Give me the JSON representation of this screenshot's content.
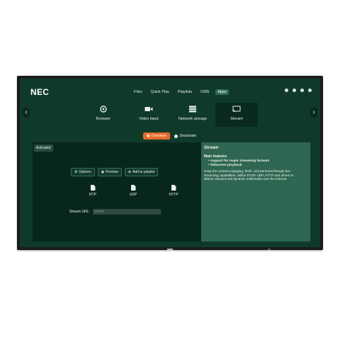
{
  "brand": "NEC",
  "topnav": [
    "Files",
    "Quick Play",
    "Playlists",
    "CMS",
    "Apps"
  ],
  "topnav_active": "Apps",
  "apps": [
    {
      "label": "Browser",
      "icon": "browser-icon"
    },
    {
      "label": "Video input",
      "icon": "video-camera-icon"
    },
    {
      "label": "Network storage",
      "icon": "storage-icon"
    },
    {
      "label": "Stream",
      "icon": "cast-icon"
    }
  ],
  "tabs": {
    "overview": "Overview",
    "deactivate": "Deactivate"
  },
  "left": {
    "status": "Activated",
    "buttons": {
      "options": "Options",
      "preview": "Preview",
      "add": "Add to playlist"
    },
    "protocols": [
      "RTP",
      "UDP",
      "HTTP"
    ],
    "url_label": "Stream URL:",
    "url_placeholder": "RTP://"
  },
  "right": {
    "title": "Stream",
    "subtitle": "Main features",
    "features": [
      "support for major streaming formats",
      "fullscreen playback"
    ],
    "description": "Keep the content engaging, fresh, and personal through live streaming capabilities. Utilize RTSP, UDP, HTTP and others to deliver relevant and dynamic multimedia over the internet."
  },
  "colors": {
    "screen": "#0f3a2b",
    "accent": "#e46a2a",
    "info_panel": "#2f6651"
  }
}
